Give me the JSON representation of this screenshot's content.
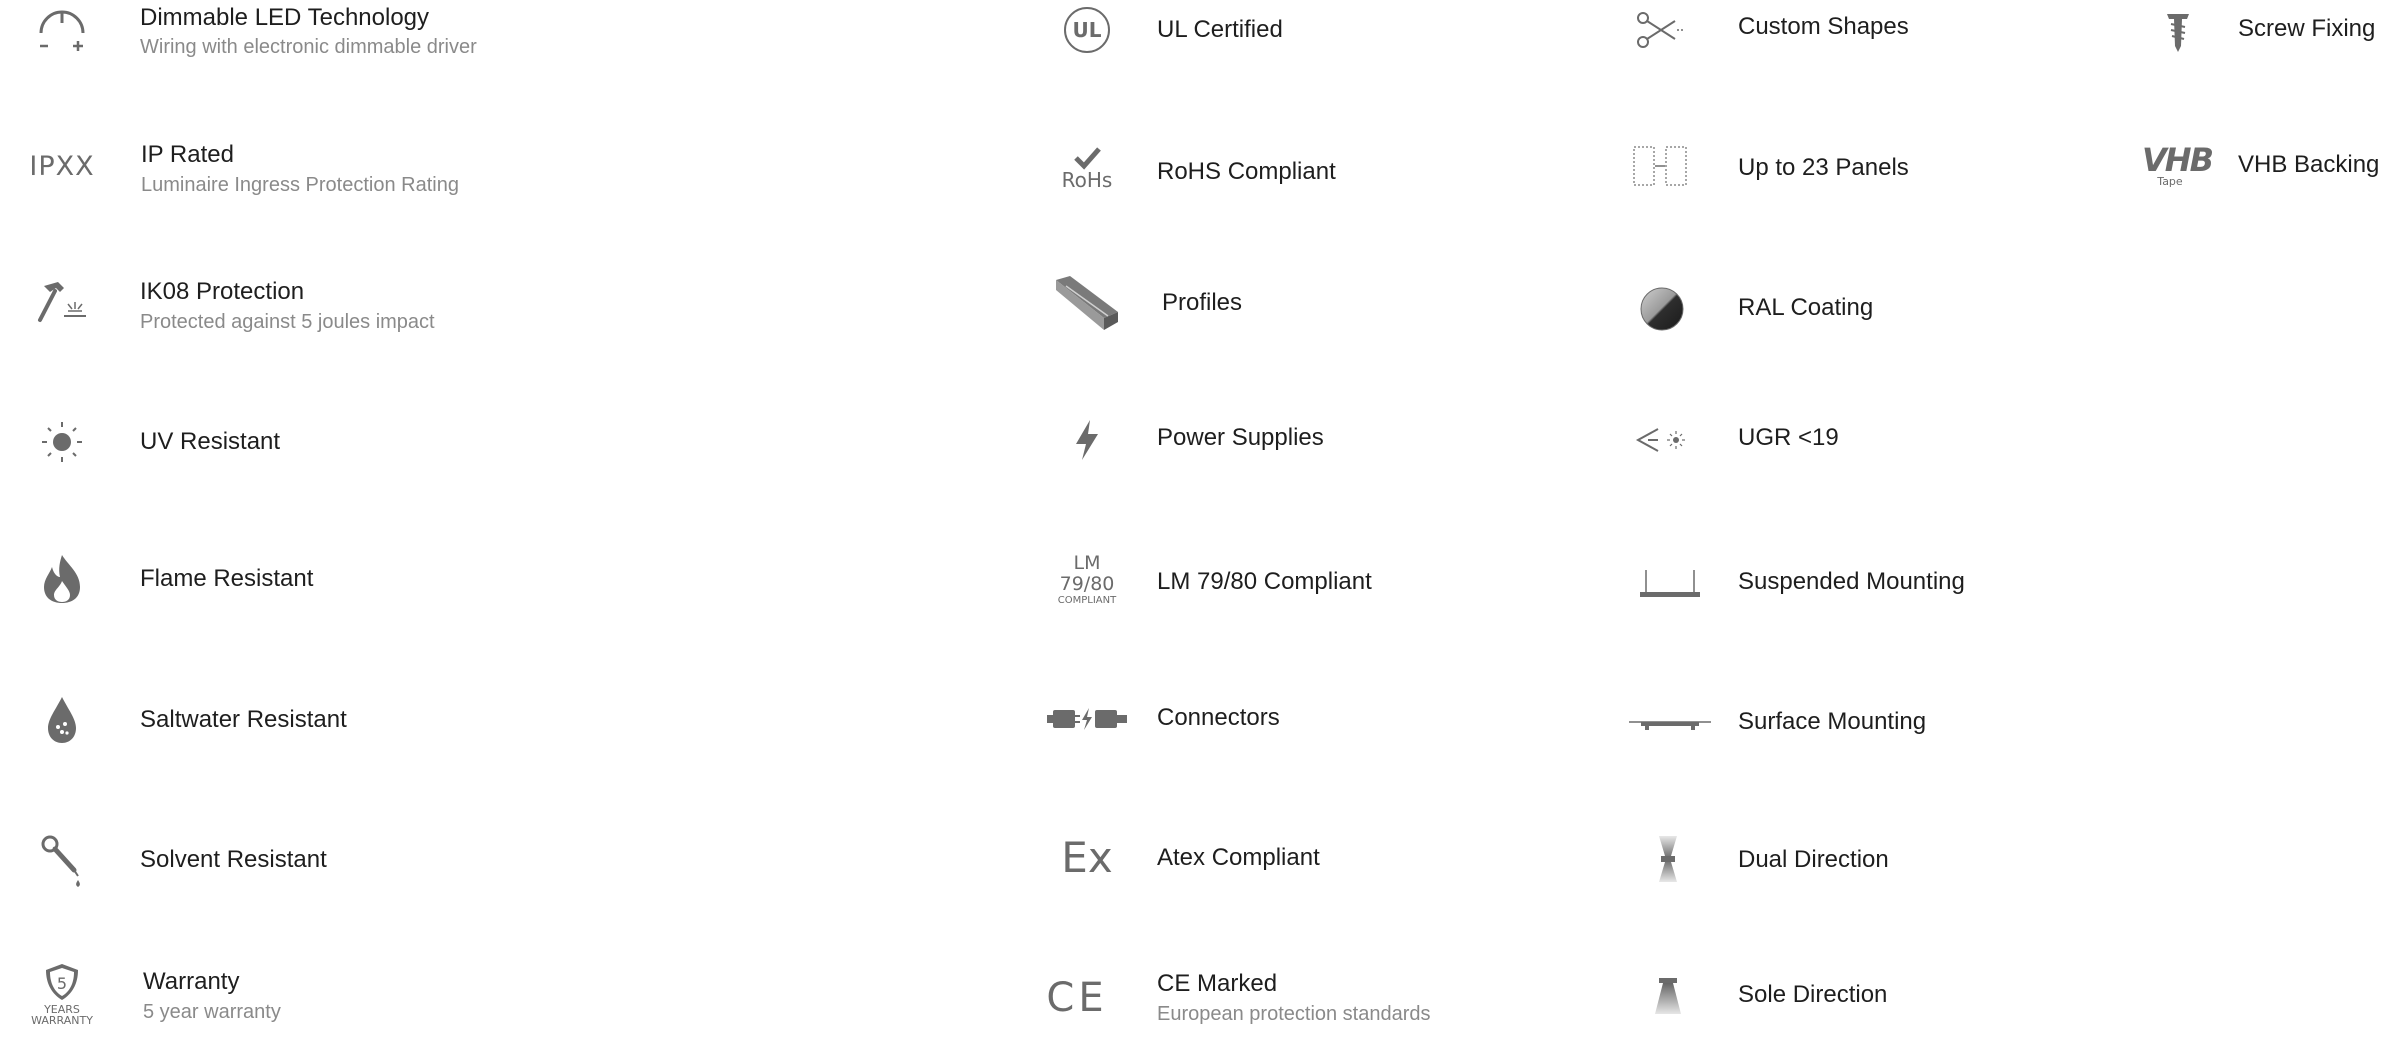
{
  "features": {
    "dimmable": {
      "title": "Dimmable LED Technology",
      "subtitle": "Wiring with electronic dimmable driver",
      "icon": "dimmer-icon"
    },
    "ul": {
      "title": "UL Certified",
      "icon": "ul-certified-icon",
      "icon_text": "UL"
    },
    "custom_shapes": {
      "title": "Custom Shapes",
      "icon": "scissors-icon"
    },
    "screw": {
      "title": "Screw Fixing",
      "icon": "screw-icon"
    },
    "ip": {
      "title": "IP Rated",
      "subtitle": "Luminaire Ingress Protection Rating",
      "icon": "ip-rating-icon",
      "icon_text": "IPXX"
    },
    "rohs": {
      "title": "RoHS Compliant",
      "icon": "rohs-icon",
      "icon_text": "RoHs"
    },
    "panels": {
      "title": "Up to 23 Panels",
      "icon": "panels-icon"
    },
    "vhb": {
      "title": "VHB Backing",
      "icon": "vhb-tape-icon",
      "icon_text": "VHB",
      "icon_subtext": "Tape"
    },
    "ik08": {
      "title": "IK08 Protection",
      "subtitle": "Protected against 5 joules impact",
      "icon": "hammer-icon"
    },
    "profiles": {
      "title": "Profiles",
      "icon": "profile-icon"
    },
    "ral": {
      "title": "RAL Coating",
      "icon": "ral-coating-icon"
    },
    "uv": {
      "title": "UV Resistant",
      "icon": "sun-icon"
    },
    "power": {
      "title": "Power Supplies",
      "icon": "lightning-icon"
    },
    "ugr": {
      "title": "UGR <19",
      "icon": "glare-icon"
    },
    "flame": {
      "title": "Flame Resistant",
      "icon": "flame-icon"
    },
    "lm": {
      "title": "LM 79/80 Compliant",
      "icon": "lm-compliant-icon",
      "icon_line1": "LM",
      "icon_line2": "79/80",
      "icon_line3": "COMPLIANT"
    },
    "suspended": {
      "title": "Suspended Mounting",
      "icon": "suspended-mount-icon"
    },
    "saltwater": {
      "title": "Saltwater Resistant",
      "icon": "water-drop-icon"
    },
    "connectors": {
      "title": "Connectors",
      "icon": "connector-icon"
    },
    "surface": {
      "title": "Surface Mounting",
      "icon": "surface-mount-icon"
    },
    "solvent": {
      "title": "Solvent Resistant",
      "icon": "pipette-icon"
    },
    "atex": {
      "title": "Atex Compliant",
      "icon": "atex-icon",
      "icon_text": "Ex"
    },
    "dual": {
      "title": "Dual Direction",
      "icon": "dual-direction-icon"
    },
    "warranty": {
      "title": "Warranty",
      "subtitle": "5 year warranty",
      "icon": "warranty-shield-icon",
      "icon_number": "5",
      "icon_line1": "YEARS",
      "icon_line2": "WARRANTY"
    },
    "ce": {
      "title": "CE Marked",
      "subtitle": "European protection standards",
      "icon": "ce-mark-icon",
      "icon_text": "CE"
    },
    "sole": {
      "title": "Sole Direction",
      "icon": "sole-direction-icon"
    }
  },
  "colors": {
    "icon": "#6b6b6b",
    "title": "#1e1e1e",
    "subtitle": "#8a8a8a",
    "background": "#ffffff"
  }
}
